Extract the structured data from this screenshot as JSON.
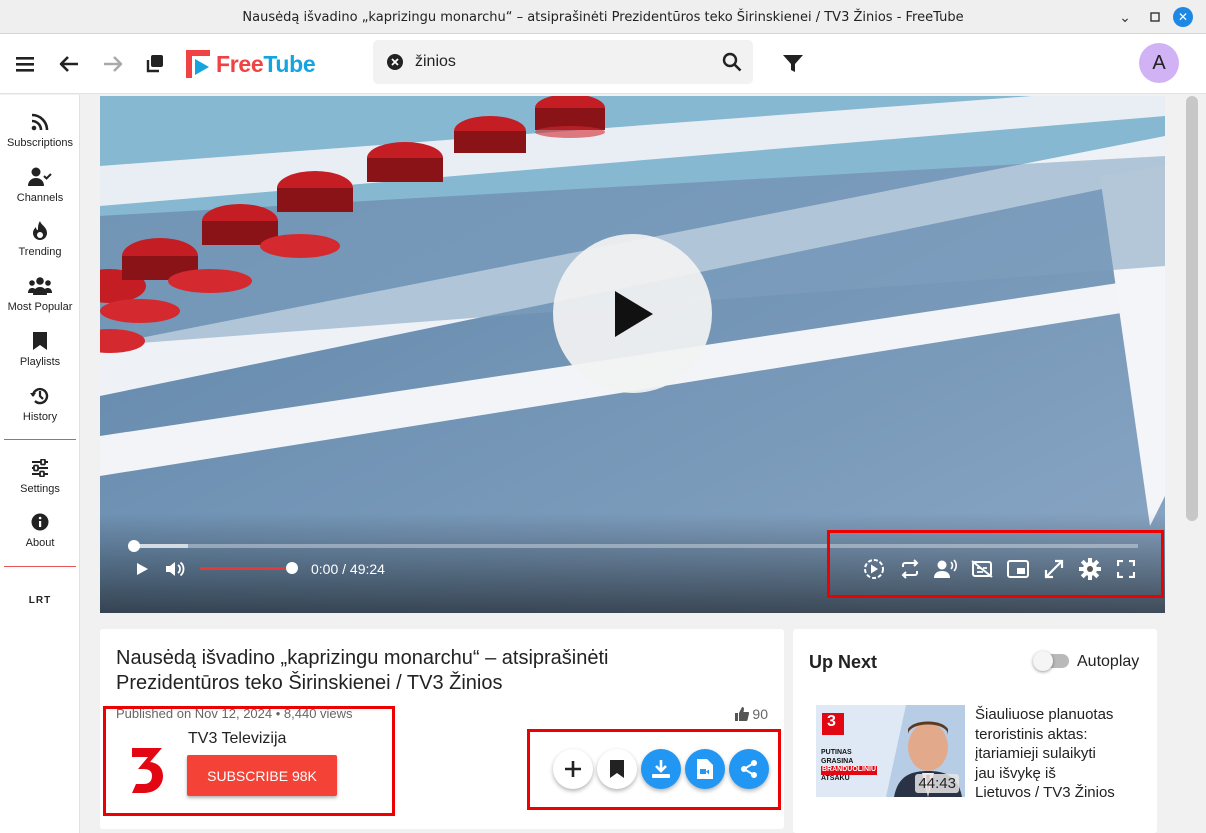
{
  "window": {
    "title": "Nausėdą išvadino „kaprizingu monarchu“ – atsiprašinėti Prezidentūros teko Širinskienei / TV3 Žinios - FreeTube"
  },
  "app": {
    "logo_text_free": "Free",
    "logo_text_tube": "Tube",
    "brand_red": "#f04242",
    "brand_blue": "#14a4df"
  },
  "search": {
    "value": "žinios"
  },
  "profile": {
    "avatar_letter": "A"
  },
  "sidebar": {
    "items": [
      {
        "label": "Subscriptions",
        "icon": "rss-icon"
      },
      {
        "label": "Channels",
        "icon": "user-check-icon"
      },
      {
        "label": "Trending",
        "icon": "fire-icon"
      },
      {
        "label": "Most Popular",
        "icon": "users-icon"
      },
      {
        "label": "Playlists",
        "icon": "bookmark-icon"
      },
      {
        "label": "History",
        "icon": "history-icon"
      },
      {
        "label": "Settings",
        "icon": "sliders-icon"
      },
      {
        "label": "About",
        "icon": "info-icon"
      }
    ],
    "channel_shortcut": "LRT"
  },
  "player": {
    "time": "0:00 / 49:24",
    "volume_fraction": 1.0,
    "progress_fraction": 0.0
  },
  "video": {
    "title": "Nausėdą išvadino „kaprizingu monarchu“ – atsiprašinėti Prezidentūros teko Širinskienei / TV3 Žinios",
    "meta": "Published on Nov 12, 2024 • 8,440 views",
    "likes": "90",
    "channel": "TV3 Televizija",
    "subscribe_label": "SUBSCRIBE 98K",
    "channel_logo_text": "3"
  },
  "upnext": {
    "heading": "Up Next",
    "autoplay_label": "Autoplay",
    "autoplay_on": false,
    "item": {
      "title": "Šiauliuose planuotas teroristinis aktas: įtariamieji sulaikyti jau išvykę iš Lietuvos / TV3 Žinios",
      "duration": "44:43",
      "thumb_text_brand": "3",
      "thumb_text_line1": "PUTINAS",
      "thumb_text_line2": "GRASINA",
      "thumb_text_line3": "BRANDUOLINIU",
      "thumb_text_line4": "ATSAKU"
    }
  }
}
